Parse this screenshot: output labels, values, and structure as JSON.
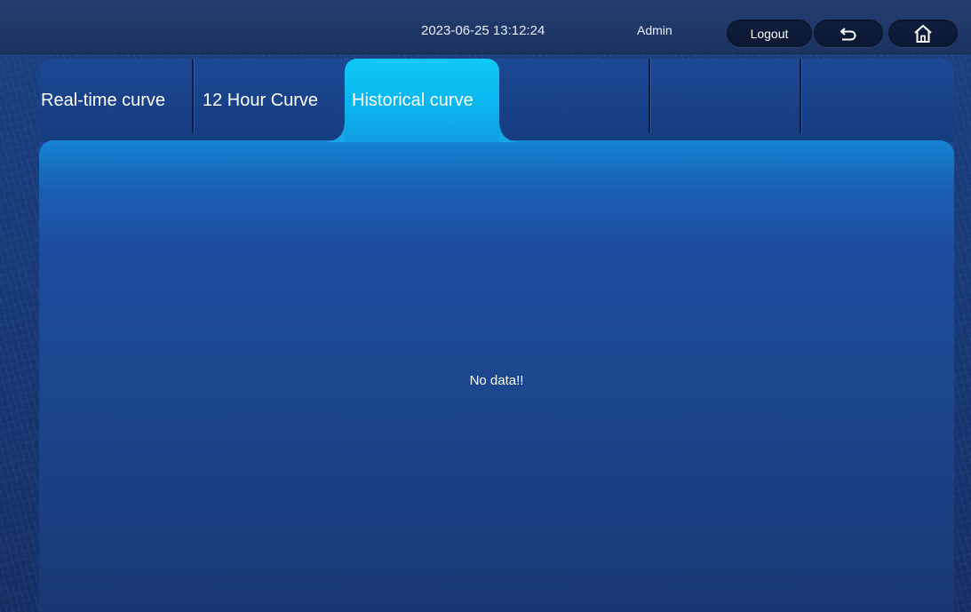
{
  "header": {
    "datetime": "2023-06-25 13:12:24",
    "user": "Admin",
    "logout_label": "Logout",
    "back_icon": "return-arrow-icon",
    "home_icon": "home-icon"
  },
  "tabs": [
    {
      "label": "Real-time curve",
      "active": false
    },
    {
      "label": "12 Hour Curve",
      "active": false
    },
    {
      "label": "Historical curve",
      "active": true
    },
    {
      "label": "",
      "active": false
    },
    {
      "label": "",
      "active": false
    },
    {
      "label": "",
      "active": false
    }
  ],
  "content": {
    "message": "No data!!"
  },
  "colors": {
    "active_tab": "#0fc8f6",
    "panel": "#1d4897",
    "topbar": "#1a325f"
  }
}
